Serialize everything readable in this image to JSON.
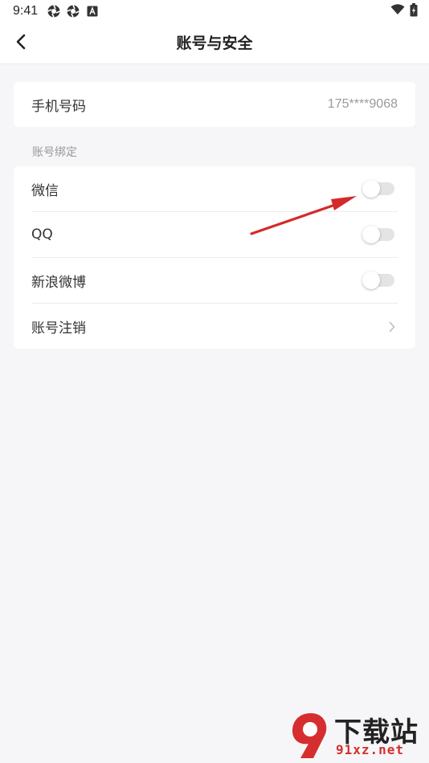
{
  "status_bar": {
    "time": "9:41",
    "icons": [
      "aperture-icon",
      "aperture-icon",
      "app-a-icon"
    ],
    "right_icons": [
      "wifi-icon",
      "battery-icon"
    ]
  },
  "nav": {
    "title": "账号与安全",
    "back_icon": "chevron-left-icon"
  },
  "phone": {
    "label": "手机号码",
    "value": "175****9068"
  },
  "binding": {
    "section_label": "账号绑定",
    "items": [
      {
        "label": "微信",
        "control": "toggle",
        "on": false
      },
      {
        "label": "QQ",
        "control": "toggle",
        "on": false
      },
      {
        "label": "新浪微博",
        "control": "toggle",
        "on": false
      },
      {
        "label": "账号注销",
        "control": "chevron"
      }
    ]
  },
  "watermark": {
    "brand": "下载站",
    "url": "91xz.net"
  },
  "colors": {
    "page_bg": "#f6f6f8",
    "card_bg": "#ffffff",
    "annotation_arrow": "#d42a2a",
    "watermark_red": "#d62e2e"
  }
}
